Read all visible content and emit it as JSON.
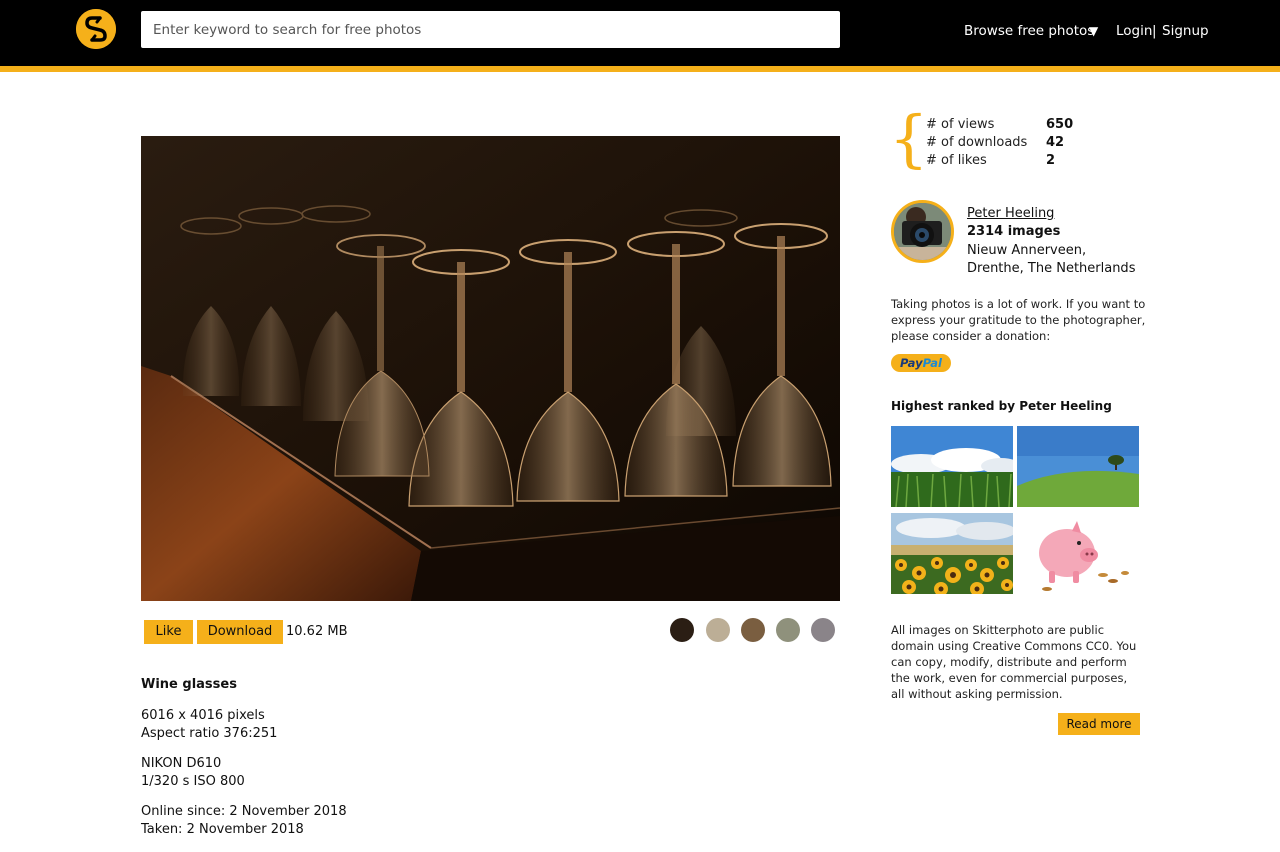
{
  "header": {
    "search_placeholder": "Enter keyword to search for free photos",
    "browse_label": "Browse free photos",
    "browse_caret": "▼",
    "login_label": "Login",
    "separator": "|",
    "signup_label": "Signup",
    "logo_icon": "skitterphoto-logo-icon"
  },
  "photo": {
    "actions": {
      "like_label": "Like",
      "download_label": "Download",
      "file_size": "10.62 MB"
    },
    "color_swatches": [
      "#2b1e14",
      "#bcae96",
      "#7a5e40",
      "#8f917c",
      "#8a8489"
    ],
    "title": "Wine glasses",
    "dimensions": "6016 x 4016 pixels",
    "aspect_ratio": "Aspect ratio 376:251",
    "camera": "NIKON D610",
    "exposure": "1/320 s ISO 800",
    "online_since": "Online since: 2 November 2018",
    "taken": "Taken: 2 November 2018"
  },
  "stats": {
    "views_label": "# of views",
    "views_value": "650",
    "downloads_label": "# of downloads",
    "downloads_value": "42",
    "likes_label": "# of likes",
    "likes_value": "2"
  },
  "author": {
    "name": "Peter Heeling",
    "image_count": "2314 images",
    "location": "Nieuw Annerveen, Drenthe, The Netherlands"
  },
  "donation": {
    "text": "Taking photos is a lot of work. If you want to express your gratitude to the photographer, please consider a donation:",
    "paypal_pay": "Pay",
    "paypal_pal": "Pal"
  },
  "ranked": {
    "title": "Highest ranked by Peter Heeling"
  },
  "license": {
    "text": "All images on Skitterphoto are public domain using Creative Commons CC0. You can copy, modify, distribute and perform the work, even for commercial purposes, all without asking permission.",
    "read_more_label": "Read more"
  },
  "colors": {
    "accent": "#f5b01a",
    "header_bg": "#000000"
  }
}
